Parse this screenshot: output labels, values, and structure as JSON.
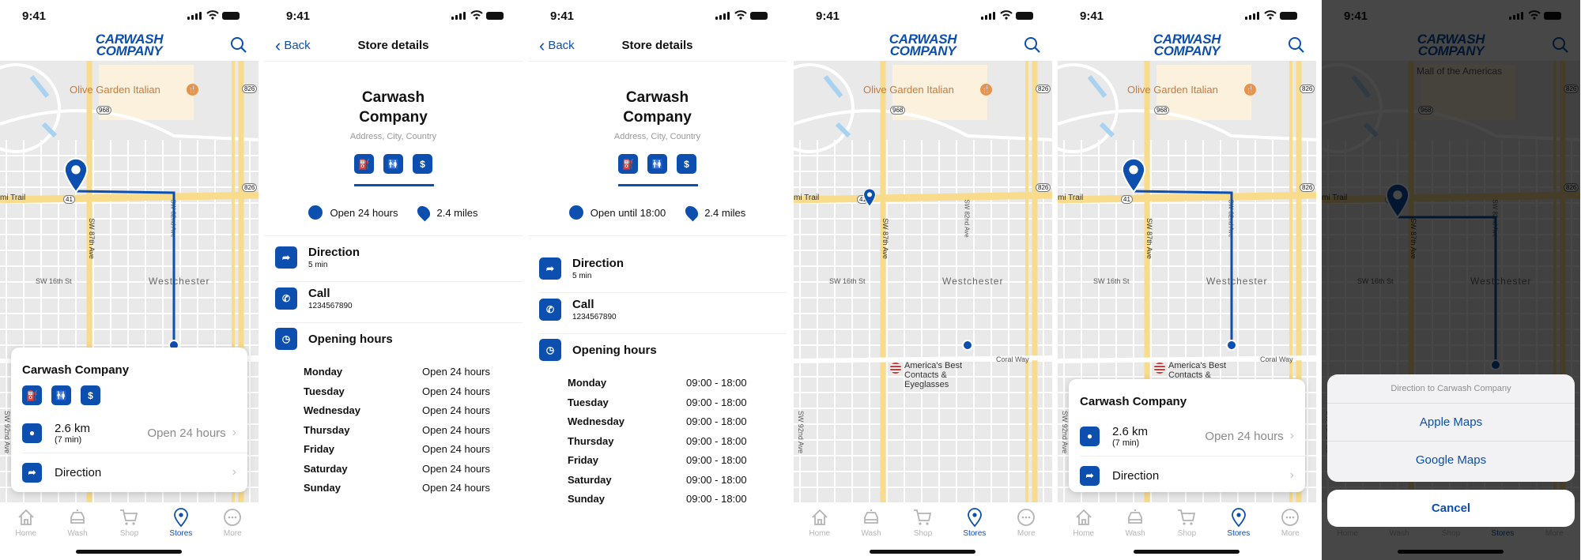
{
  "status": {
    "time": "9:41"
  },
  "brand": {
    "line1": "CARWASH",
    "line2": "COMPANY"
  },
  "colors": {
    "accent": "#0d4fae",
    "road": "#f8dc8b",
    "map_bg": "#e9e9e9"
  },
  "tabs": [
    {
      "label": "Home",
      "icon": "home-icon"
    },
    {
      "label": "Wash",
      "icon": "car-icon"
    },
    {
      "label": "Shop",
      "icon": "cart-icon"
    },
    {
      "label": "Stores",
      "icon": "location-pin-icon"
    },
    {
      "label": "More",
      "icon": "more-icon"
    }
  ],
  "active_tab": "Stores",
  "map_labels": {
    "poi": "Olive Garden Italian",
    "area": "Westchester",
    "street1": "SW 87th Ave",
    "street2": "SW 16th St",
    "street3": "SW 92nd Ave",
    "street4": "SW 82nd Ave",
    "trail": "mi Trail",
    "shield1": "968",
    "shield2": "826",
    "shield3": "41",
    "store": "America's Best Contacts & Eyeglasses",
    "coral": "Coral Way",
    "mall": "Mall of the Americas"
  },
  "card": {
    "title": "Carwash Company",
    "services": [
      "fuel-icon",
      "restroom-icon",
      "atm-icon"
    ],
    "distance": "2.6 km",
    "duration": "(7 min)",
    "hours": "Open 24 hours",
    "direction": "Direction"
  },
  "detail": {
    "back": "Back",
    "title": "Store details",
    "name_line1": "Carwash",
    "name_line2": "Company",
    "address": "Address, City, Country",
    "distance": "2.4 miles",
    "direction": "Direction",
    "direction_time": "5 min",
    "call": "Call",
    "phone": "1234567890",
    "opening_hours": "Opening hours",
    "variants": [
      {
        "status": "Open 24 hours",
        "hours": [
          {
            "day": "Monday",
            "hours": "Open 24 hours"
          },
          {
            "day": "Tuesday",
            "hours": "Open 24 hours"
          },
          {
            "day": "Wednesday",
            "hours": "Open 24 hours"
          },
          {
            "day": "Thursday",
            "hours": "Open 24 hours"
          },
          {
            "day": "Friday",
            "hours": "Open 24 hours"
          },
          {
            "day": "Saturday",
            "hours": "Open 24 hours"
          },
          {
            "day": "Sunday",
            "hours": "Open 24 hours"
          }
        ]
      },
      {
        "status": "Open until 18:00",
        "hours": [
          {
            "day": "Monday",
            "hours": "09:00 - 18:00"
          },
          {
            "day": "Tuesday",
            "hours": "09:00 - 18:00"
          },
          {
            "day": "Wednesday",
            "hours": "09:00 - 18:00"
          },
          {
            "day": "Thursday",
            "hours": "09:00 - 18:00"
          },
          {
            "day": "Friday",
            "hours": "09:00 - 18:00"
          },
          {
            "day": "Saturday",
            "hours": "09:00 - 18:00"
          },
          {
            "day": "Sunday",
            "hours": "09:00 - 18:00"
          }
        ]
      }
    ]
  },
  "action_sheet": {
    "title": "Direction to Carwash Company",
    "options": [
      "Apple Maps",
      "Google Maps"
    ],
    "cancel": "Cancel"
  }
}
